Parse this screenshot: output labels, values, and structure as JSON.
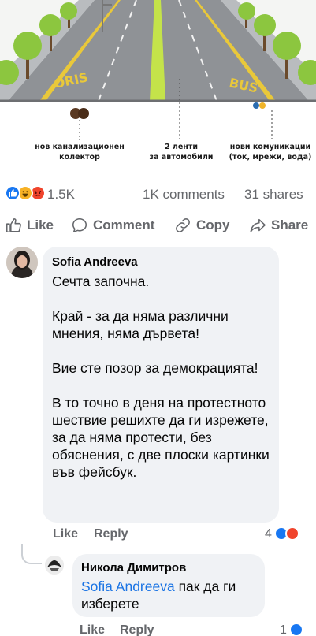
{
  "illustration": {
    "road_marking_left": "ORIS",
    "road_marking_right": "BUS",
    "captions": {
      "sewer": "нов канализационен\nколектор",
      "lanes": "2 ленти\nза автомобили",
      "utilities": "нови комуникации\n(ток, мрежи, вода)"
    }
  },
  "post_stats": {
    "reactions_count": "1.5K",
    "comments_count": "1K comments",
    "shares_count": "31 shares",
    "reaction_icons": [
      "like-reaction-icon",
      "haha-reaction-icon",
      "angry-reaction-icon"
    ]
  },
  "actions": {
    "like": "Like",
    "comment": "Comment",
    "copy": "Copy",
    "share": "Share"
  },
  "comments": [
    {
      "author": "Sofia Andreeva",
      "paragraphs": [
        "Сечта започна.",
        "Край - за да няма различни мнения, няма дървета!",
        "Вие сте позор за демокрацията!",
        "В то точно в деня на протестното шествие решихте да ги изрежете, за да няма протести, без обяснения, с две плоски картинки във фейсбук."
      ],
      "like_label": "Like",
      "reply_label": "Reply",
      "reaction_count": "4"
    },
    {
      "author": "Никола Димитров",
      "mention": "Sofia Andreeva",
      "text": " пак да ги изберете",
      "like_label": "Like",
      "reply_label": "Reply",
      "reaction_count": "1"
    }
  ],
  "colors": {
    "meta_gray": "#65676b",
    "bubble_bg": "#f0f2f5",
    "link_blue": "#1b74e4",
    "like_blue": "#1877f2",
    "angry_red": "#f0442c",
    "haha_yellow": "#f7b125",
    "tree_green": "#8cc63f",
    "median_green": "#c4e34a"
  }
}
